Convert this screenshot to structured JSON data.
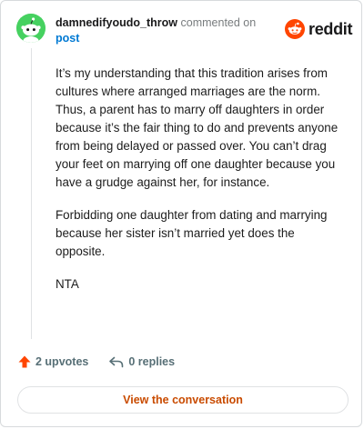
{
  "comment": {
    "username": "damnedifyoudo_throw",
    "commented_text": "commented on",
    "post_link": "post",
    "paragraphs": [
      "It’s my understanding that this tradition arises from cultures where arranged marriages are the norm. Thus, a parent has to marry off daughters in order because it’s the fair thing to do and prevents anyone from being delayed or passed over. You can’t drag your feet on marrying off one daughter because you have a grudge against her, for instance.",
      "Forbidding one daughter from dating and marrying because her sister isn’t married yet does the opposite.",
      "NTA"
    ]
  },
  "brand": {
    "name": "reddit",
    "color": "#ff4500"
  },
  "avatar": {
    "color": "#46d160",
    "icon": "snoo-avatar-icon"
  },
  "actions": {
    "upvotes": "2 upvotes",
    "replies": "0 replies",
    "upvote_color": "#ff4500"
  },
  "cta": {
    "label": "View the conversation",
    "color": "#c94b00"
  }
}
